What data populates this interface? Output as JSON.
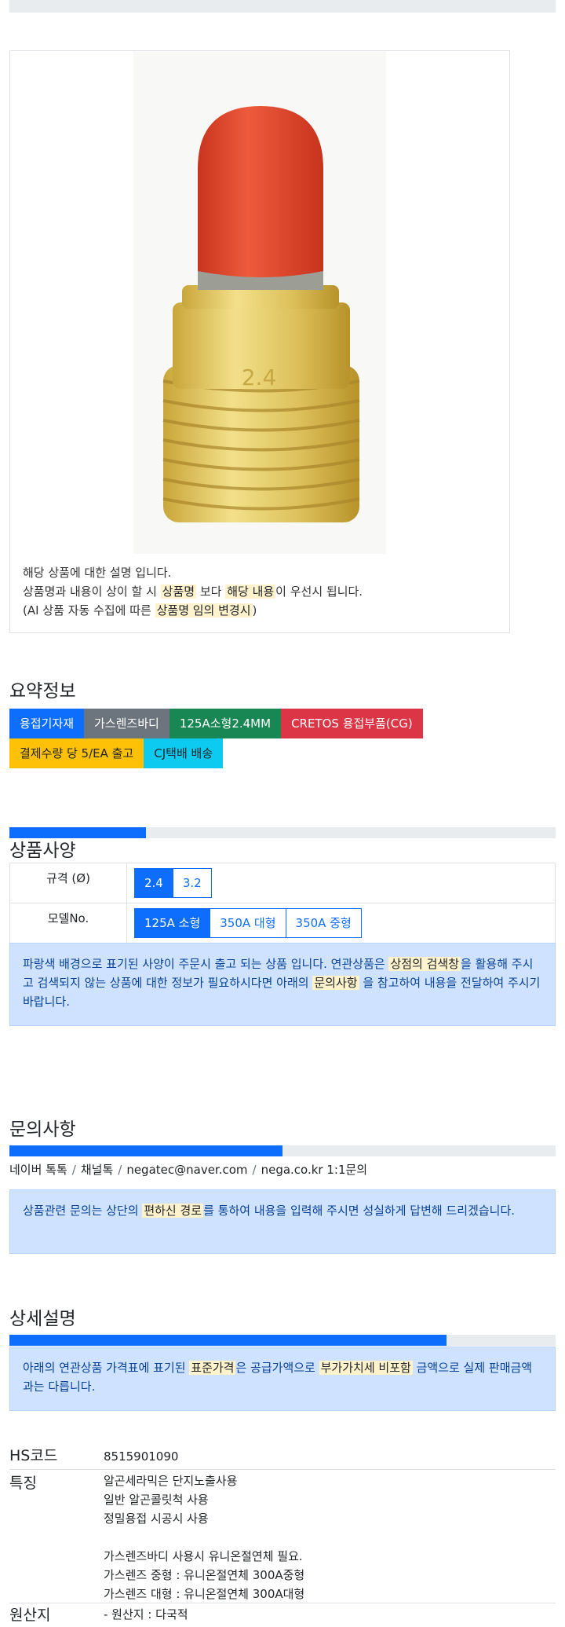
{
  "product_card": {
    "desc_line1": "해당 상품에 대한 설명 입니다.",
    "desc_line2_a": "상품명과 내용이 상이 할 시 ",
    "desc_line2_mark1": "상품명",
    "desc_line2_b": " 보다 ",
    "desc_line2_mark2": "해당 내용",
    "desc_line2_c": "이 우선시 됩니다.",
    "desc_line3_a": "(AI 상품 자동 수집에 따른 ",
    "desc_line3_mark": "상품명 임의 변경시",
    "desc_line3_b": ")",
    "image_engraving": "2.4",
    "image_cap_color": "#e8452b",
    "image_brass_color": "#e3c95c"
  },
  "summary": {
    "title": "요약정보",
    "badges": [
      {
        "label": "용접기자재",
        "color": "#0d6efd"
      },
      {
        "label": "가스렌즈바디",
        "color": "#6c757d"
      },
      {
        "label": "125A소형2.4MM",
        "color": "#198754"
      },
      {
        "label": "CRETOS 용접부품(CG)",
        "color": "#dc3545"
      },
      {
        "label": "결제수량 당 5/EA 출고",
        "color": "#ffc107"
      },
      {
        "label": "CJ택배 배송",
        "color": "#0dcaf0"
      }
    ]
  },
  "spec": {
    "title": "상품사양",
    "progress_percent": 25,
    "rows": [
      {
        "label": "규격 (Ø)",
        "options": [
          "2.4",
          "3.2"
        ],
        "selected": "2.4"
      },
      {
        "label": "모델No.",
        "options": [
          "125A 소형",
          "350A 대형",
          "350A 중형"
        ],
        "selected": "125A 소형"
      }
    ],
    "alert_a": "파랑색 배경으로 표기된 사양이 주문시 출고 되는 상품 입니다. 연관상품은 ",
    "alert_mark1": "상점의 검색창",
    "alert_b": "을 활용해 주시고 검색되지 않는 상품에 대한 정보가 필요하시다면 아래의 ",
    "alert_mark2": "문의사항",
    "alert_c": " 을 참고하여 내용을 전달하여 주시기 바랍니다."
  },
  "inquiry": {
    "title": "문의사항",
    "progress_percent": 50,
    "contacts": [
      "네이버 톡톡",
      "채널톡",
      "negatec@naver.com",
      "nega.co.kr 1:1문의"
    ],
    "alert_a": "상품관련 문의는 상단의 ",
    "alert_mark": "편하신 경로",
    "alert_b": "를 통하여 내용을 입력해 주시면 성실하게 답변해 드리겠습니다."
  },
  "detail": {
    "title": "상세설명",
    "progress_percent": 80,
    "alert_a": "아래의 연관상품 가격표에 표기된 ",
    "alert_mark1": "표준가격",
    "alert_b": "은 공급가액으로 ",
    "alert_mark2": "부가가치세 비포함",
    "alert_c": " 금액으로 실제 판매금액과는 다릅니다.",
    "hs_label": "HS코드",
    "hs_value": "8515901090",
    "feature_label": "특징",
    "features": [
      "알곤세라믹은 단지노출사용",
      "일반 알곤콜릿척 사용",
      "정밀용접 시공시 사용",
      "",
      "가스렌즈바디 사용시 유니온절연체 필요.",
      "가스렌즈 중형 : 유니온절연체 300A중형",
      "가스렌즈 대형 : 유니온절연체 300A대형"
    ],
    "origin_label": "원산지",
    "origin_value": "- 원산지 : 다국적"
  }
}
